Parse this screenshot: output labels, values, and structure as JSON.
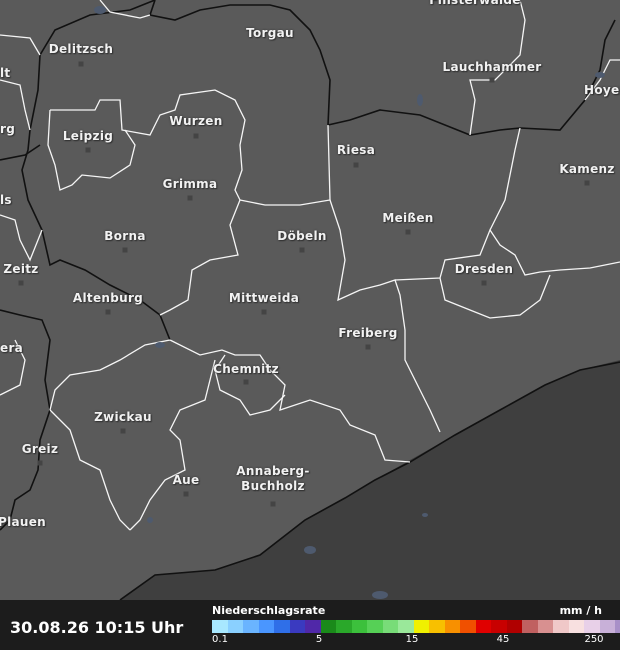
{
  "map": {
    "cities": [
      {
        "name": "Finsterwalde",
        "dot": false
      },
      {
        "name": "Torgau",
        "dot": false
      },
      {
        "name": "Delitzsch",
        "dot": true
      },
      {
        "name": "Lauchhammer",
        "dot": true
      },
      {
        "name": "Hoyer",
        "dot": false
      },
      {
        "name": "Leipzig",
        "dot": true
      },
      {
        "name": "Wurzen",
        "dot": true
      },
      {
        "name": "Riesa",
        "dot": true
      },
      {
        "name": "Kamenz",
        "dot": true
      },
      {
        "name": "Grimma",
        "dot": true
      },
      {
        "name": "Meißen",
        "dot": true
      },
      {
        "name": "Borna",
        "dot": true
      },
      {
        "name": "Döbeln",
        "dot": true
      },
      {
        "name": "Dresden",
        "dot": true
      },
      {
        "name": "Zeitz",
        "dot": true
      },
      {
        "name": "Altenburg",
        "dot": true
      },
      {
        "name": "Mittweida",
        "dot": true
      },
      {
        "name": "Freiberg",
        "dot": true
      },
      {
        "name": "Chemnitz",
        "dot": true
      },
      {
        "name": "Zwickau",
        "dot": true
      },
      {
        "name": "Greiz",
        "dot": true
      },
      {
        "name": "Aue",
        "dot": true
      },
      {
        "name": "Annaberg-\nBuchholz",
        "dot": true
      },
      {
        "name": "Plauen",
        "dot": false
      },
      {
        "name": "lt",
        "dot": false
      },
      {
        "name": "rg",
        "dot": false
      },
      {
        "name": "ls",
        "dot": false
      },
      {
        "name": "era",
        "dot": false
      }
    ]
  },
  "footer": {
    "timestamp": "30.08.26 10:15 Uhr",
    "legend_title": "Niederschlagsrate",
    "legend_unit": "mm / h",
    "legend_colors": [
      "#a8e8ff",
      "#8ad0ff",
      "#6ab4ff",
      "#4a96ff",
      "#2f6fe8",
      "#3a3ac0",
      "#5028a8",
      "#1a8a1a",
      "#2aa82a",
      "#3cc03c",
      "#56d056",
      "#78dc78",
      "#9ae89a",
      "#f0f000",
      "#f8c000",
      "#f89000",
      "#f05000",
      "#e00000",
      "#c80000",
      "#b00000",
      "#c06060",
      "#d89090",
      "#f0c8c8",
      "#f8e0e0",
      "#e8d0e8",
      "#c8b0d8",
      "#a890c8",
      "#9070b0"
    ],
    "legend_ticks": [
      "0.1",
      "5",
      "15",
      "45",
      "250"
    ]
  }
}
